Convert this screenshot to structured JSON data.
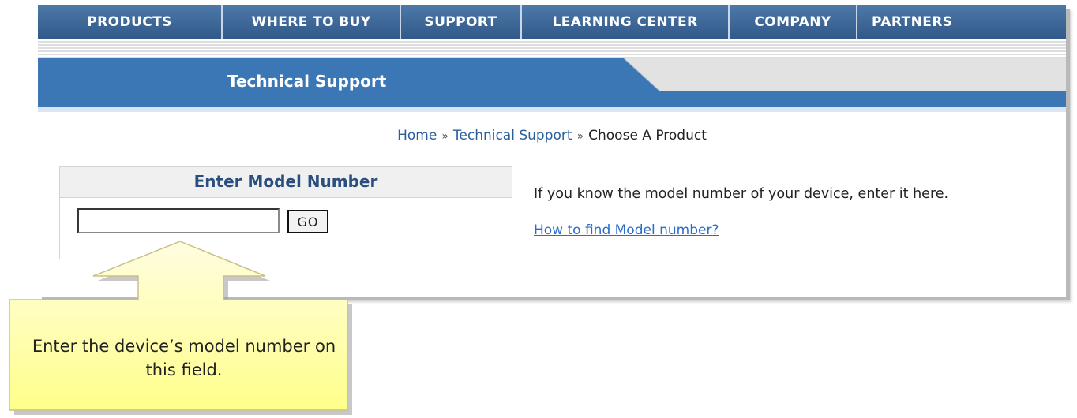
{
  "nav": {
    "items": [
      {
        "label": "PRODUCTS"
      },
      {
        "label": "WHERE TO BUY"
      },
      {
        "label": "SUPPORT"
      },
      {
        "label": "LEARNING CENTER"
      },
      {
        "label": "COMPANY"
      },
      {
        "label": "PARTNERS"
      }
    ]
  },
  "section": {
    "title": "Technical Support"
  },
  "breadcrumb": {
    "items": [
      "Home",
      "Technical Support",
      "Choose A Product"
    ],
    "separator": "»"
  },
  "model_box": {
    "heading": "Enter Model Number",
    "input_value": "",
    "go_label": "GO"
  },
  "info": {
    "text": "If you know the model number of your device, enter it here.",
    "link": "How to find Model number?"
  },
  "callout": {
    "text": "Enter the device’s model number on this field."
  },
  "colors": {
    "nav_blue": "#3b6797",
    "accent_blue": "#3c77b5",
    "callout_yellow": "#ffff99",
    "link_blue": "#2a6cc8"
  }
}
